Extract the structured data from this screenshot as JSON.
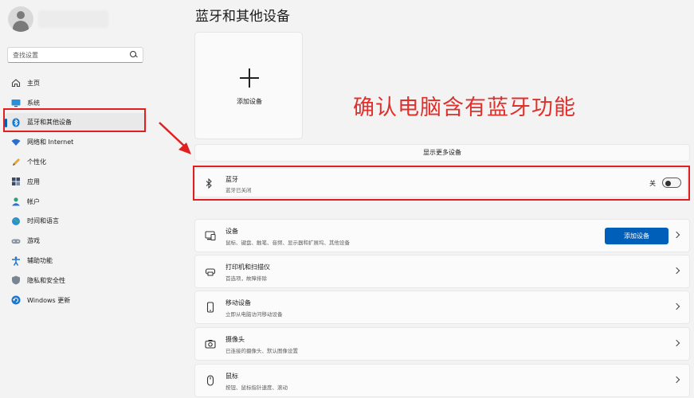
{
  "sidebar": {
    "search_placeholder": "查找设置",
    "items": [
      {
        "label": "主页",
        "icon": "home-icon"
      },
      {
        "label": "系统",
        "icon": "monitor-icon"
      },
      {
        "label": "蓝牙和其他设备",
        "icon": "bluetooth-icon",
        "active": true
      },
      {
        "label": "网络和 Internet",
        "icon": "wifi-icon"
      },
      {
        "label": "个性化",
        "icon": "pen-icon"
      },
      {
        "label": "应用",
        "icon": "apps-icon"
      },
      {
        "label": "帐户",
        "icon": "account-icon"
      },
      {
        "label": "时间和语言",
        "icon": "globe-icon"
      },
      {
        "label": "游戏",
        "icon": "gamepad-icon"
      },
      {
        "label": "辅助功能",
        "icon": "accessibility-icon"
      },
      {
        "label": "隐私和安全性",
        "icon": "shield-icon"
      },
      {
        "label": "Windows 更新",
        "icon": "update-icon"
      }
    ]
  },
  "main": {
    "title": "蓝牙和其他设备",
    "add_device_label": "添加设备",
    "annotation": "确认电脑含有蓝牙功能",
    "more_devices": "显示更多设备",
    "bluetooth": {
      "title": "蓝牙",
      "subtitle": "蓝牙已关闭",
      "toggle_label": "关",
      "toggle_on": false
    },
    "rows": [
      {
        "title": "设备",
        "subtitle": "鼠标、键盘、触笔、音频、显示器和扩展坞、其他设备",
        "icon": "devices-icon",
        "button": "添加设备"
      },
      {
        "title": "打印机和扫描仪",
        "subtitle": "首选项，故障排除",
        "icon": "printer-icon"
      },
      {
        "title": "移动设备",
        "subtitle": "立即从电脑访问移动设备",
        "icon": "phone-icon"
      },
      {
        "title": "摄像头",
        "subtitle": "已连接的摄像头、默认图像设置",
        "icon": "camera-icon"
      },
      {
        "title": "鼠标",
        "subtitle": "按钮、鼠标指针速度、滚动",
        "icon": "mouse-icon"
      }
    ]
  },
  "colors": {
    "accent": "#005fb8",
    "highlight": "#e02020",
    "annotation": "#e0302b"
  }
}
